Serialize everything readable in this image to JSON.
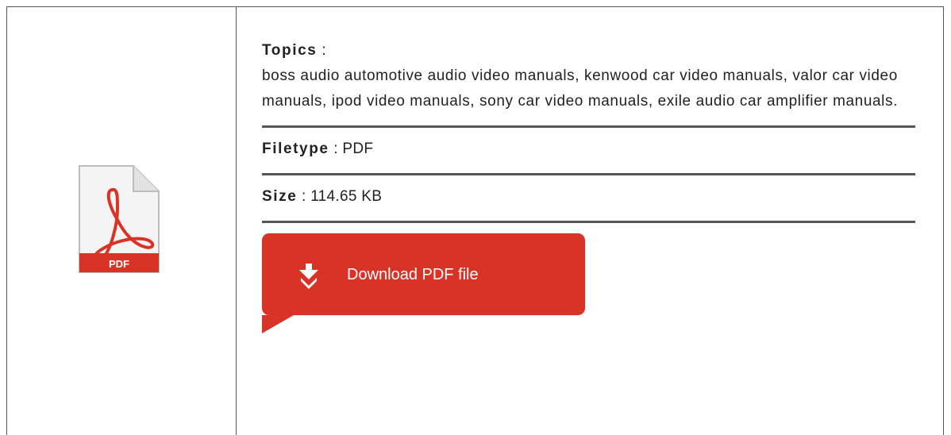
{
  "pdf_icon": {
    "label": "PDF",
    "accent_color": "#d93327"
  },
  "topics": {
    "label": "Topics",
    "separator": ":",
    "text": "boss audio automotive audio video manuals, kenwood car video manuals, valor car video manuals, ipod video manuals, sony car video manuals, exile audio car amplifier manuals."
  },
  "filetype": {
    "label": "Filetype",
    "separator": ":",
    "value": "PDF"
  },
  "size": {
    "label": "Size",
    "separator": ":",
    "value": "114.65 KB"
  },
  "download": {
    "label": "Download PDF file",
    "icon": "download-arrows-icon",
    "color": "#d93327"
  }
}
